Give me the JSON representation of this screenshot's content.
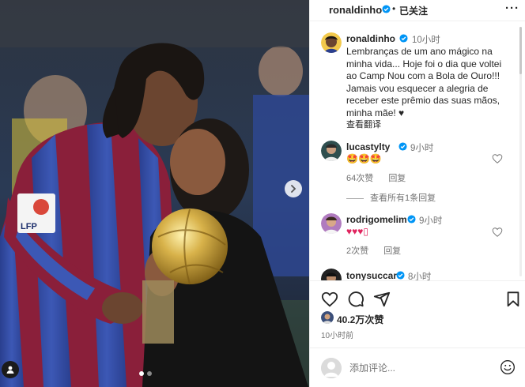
{
  "post": {
    "author": "ronaldinho",
    "follow_state": "已关注",
    "separator": "•",
    "more_label": "···",
    "photo": {
      "jersey_badge_text": "LFP",
      "slide_count": 2,
      "active_slide": 1,
      "next_icon": "chevron-right-icon",
      "tag_icon": "user-tag-icon"
    }
  },
  "caption": {
    "author": "ronaldinho",
    "time": "10小时",
    "text": "Lembranças de um ano mágico na minha vida... Hoje foi o dia que voltei ao Camp Nou com a Bola de Ouro!!! Jamais vou esquecer a alegria de receber este prêmio das suas mãos, minha mãe! ♥",
    "translate_label": "查看翻译"
  },
  "comments": [
    {
      "user": "lucastylty",
      "time": "9小时",
      "text": "🤩🤩🤩",
      "likes": "64次赞",
      "reply_label": "回复",
      "view_replies": "查看所有1条回复"
    },
    {
      "user": "rodrigomelim",
      "time": "9小时",
      "text": "♥♥♥▯",
      "likes": "2次赞",
      "reply_label": "回复"
    },
    {
      "user": "tonysuccar",
      "time": "8小时"
    }
  ],
  "actions": {
    "like_icon": "heart-icon",
    "comment_icon": "comment-icon",
    "share_icon": "send-icon",
    "save_icon": "bookmark-icon"
  },
  "stats": {
    "likes": "40.2万次赞",
    "posted": "10小时前"
  },
  "add_comment": {
    "placeholder": "添加评论...",
    "emoji_icon": "smiley-icon"
  },
  "colors": {
    "verified": "#0095f6",
    "text": "#262626",
    "secondary": "#737373",
    "heart_red": "#ed4956"
  }
}
